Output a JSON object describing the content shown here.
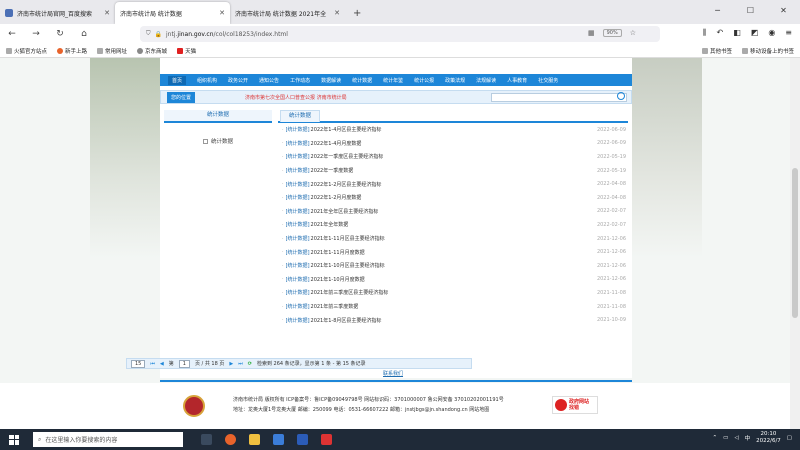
{
  "browser": {
    "tabs": [
      {
        "title": "济南市统计局官网_百度搜索",
        "active": false
      },
      {
        "title": "济南市统计局 统计数据",
        "active": true
      },
      {
        "title": "济南市统计局 统计数据 2021年全",
        "active": false
      }
    ],
    "url_prefix": "jntj.",
    "url_domain": "jinan.gov.cn",
    "url_path": "/col/col18253/index.html",
    "zoom": "90%",
    "bookmarks": [
      "火狐官方站点",
      "新手上路",
      "常用网址",
      "京东商城",
      "天猫"
    ],
    "bookmarks_right": [
      "其他书签",
      "移动设备上的书签"
    ]
  },
  "site": {
    "nav": [
      "首页",
      "组织机构",
      "政务公开",
      "通知公告",
      "工作动态",
      "数据解读",
      "统计数据",
      "统计年鉴",
      "统计公报",
      "政策法规",
      "法规解读",
      "人事教育",
      "社交服务"
    ],
    "current_label": "您的位置",
    "marquee": "济南市第七次全国人口普查公报 济南市统计局",
    "sidebar_header": "统计数据",
    "sidebar_item": "统计数据",
    "main_header": "统计数据",
    "rows": [
      {
        "cat": "统计数据",
        "title": "2022年1-4月区县主要经济指标",
        "date": "2022-06-09"
      },
      {
        "cat": "统计数据",
        "title": "2022年1-4月月度数据",
        "date": "2022-06-09"
      },
      {
        "cat": "统计数据",
        "title": "2022年一季度区县主要经济指标",
        "date": "2022-05-19"
      },
      {
        "cat": "统计数据",
        "title": "2022年一季度数据",
        "date": "2022-05-19"
      },
      {
        "cat": "统计数据",
        "title": "2022年1-2月区县主要经济指标",
        "date": "2022-04-08"
      },
      {
        "cat": "统计数据",
        "title": "2022年1-2月月度数据",
        "date": "2022-04-08"
      },
      {
        "cat": "统计数据",
        "title": "2021年全年区县主要经济指标",
        "date": "2022-02-07"
      },
      {
        "cat": "统计数据",
        "title": "2021年全年数据",
        "date": "2022-02-07"
      },
      {
        "cat": "统计数据",
        "title": "2021年1-11月区县主要经济指标",
        "date": "2021-12-06"
      },
      {
        "cat": "统计数据",
        "title": "2021年1-11月月度数据",
        "date": "2021-12-06"
      },
      {
        "cat": "统计数据",
        "title": "2021年1-10月区县主要经济指标",
        "date": "2021-12-06"
      },
      {
        "cat": "统计数据",
        "title": "2021年1-10月月度数据",
        "date": "2021-12-06"
      },
      {
        "cat": "统计数据",
        "title": "2021年前三季度区县主要经济指标",
        "date": "2021-11-08"
      },
      {
        "cat": "统计数据",
        "title": "2021年前三季度数据",
        "date": "2021-11-08"
      },
      {
        "cat": "统计数据",
        "title": "2021年1-8月区县主要经济指标",
        "date": "2021-10-09"
      }
    ],
    "pager": {
      "page_size": "15",
      "page_prefix": "第",
      "page": "1",
      "page_suffix": "页 / 共 18 页",
      "summary": "检索到 264 条记录，显示第 1 条 - 第 15 条记录"
    },
    "footer_link": "联系我们",
    "footer": {
      "line1": "济南市统计局 版权所有 ICP备案号：鲁ICP备09049798号 网站标识码：3701000007  鲁公网安备 37010202001191号",
      "line2": "地址：龙奥大厦1号龙奥大厦 邮编：250099 电话：0531-66607222 邮箱：jnstjbgs@jn.shandong.cn 网站地图"
    },
    "gov_badge_1": "政府网站",
    "gov_badge_2": "找错"
  },
  "taskbar": {
    "search_placeholder": "在这里输入你要搜索的内容",
    "time": "20:10",
    "date": "2022/6/7",
    "ime": "中"
  }
}
